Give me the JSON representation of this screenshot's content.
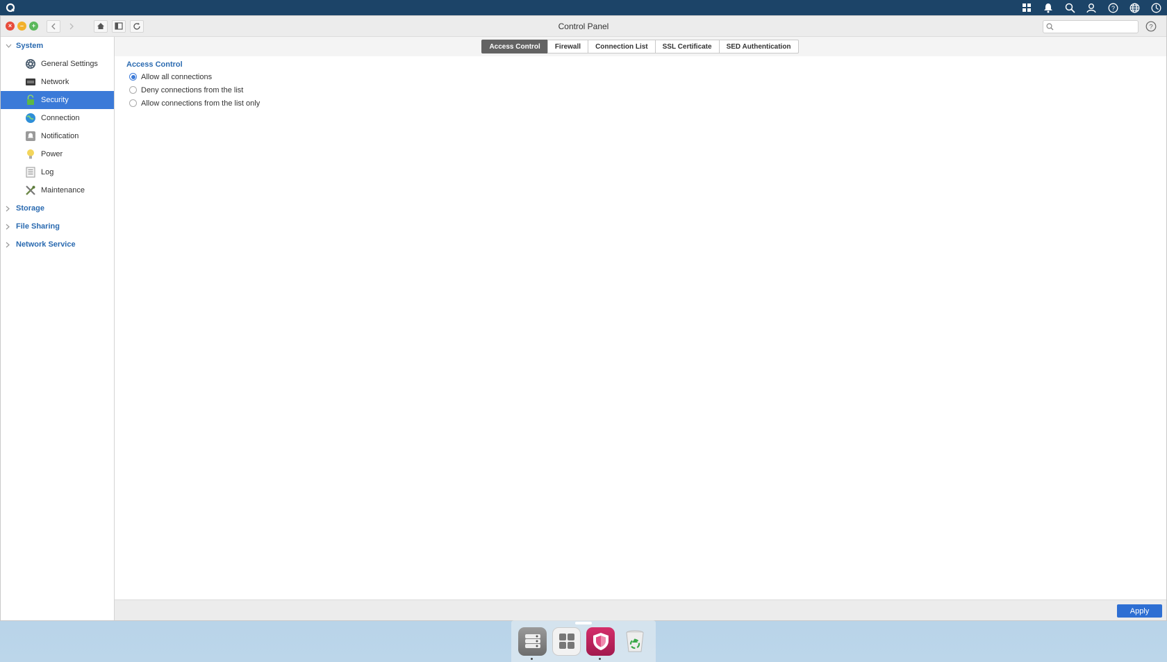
{
  "window": {
    "title": "Control Panel"
  },
  "search": {
    "placeholder": ""
  },
  "sidebar": {
    "groups": [
      {
        "label": "System",
        "expanded": true,
        "items": [
          {
            "label": "General Settings",
            "icon": "gear-icon"
          },
          {
            "label": "Network",
            "icon": "network-icon"
          },
          {
            "label": "Security",
            "icon": "lock-icon",
            "active": true
          },
          {
            "label": "Connection",
            "icon": "globe-icon"
          },
          {
            "label": "Notification",
            "icon": "notification-icon"
          },
          {
            "label": "Power",
            "icon": "lightbulb-icon"
          },
          {
            "label": "Log",
            "icon": "log-icon"
          },
          {
            "label": "Maintenance",
            "icon": "tools-icon"
          }
        ]
      },
      {
        "label": "Storage",
        "expanded": false
      },
      {
        "label": "File Sharing",
        "expanded": false
      },
      {
        "label": "Network Service",
        "expanded": false
      }
    ]
  },
  "tabs": [
    {
      "label": "Access Control",
      "active": true
    },
    {
      "label": "Firewall"
    },
    {
      "label": "Connection List"
    },
    {
      "label": "SSL Certificate"
    },
    {
      "label": "SED Authentication"
    }
  ],
  "access_control": {
    "title": "Access Control",
    "options": [
      {
        "label": "Allow all connections",
        "checked": true
      },
      {
        "label": "Deny connections from the list",
        "checked": false
      },
      {
        "label": "Allow connections from the list only",
        "checked": false
      }
    ]
  },
  "footer": {
    "apply_label": "Apply"
  },
  "colors": {
    "accent": "#3b7ad8",
    "topbar": "#1c4468",
    "link": "#2a6ab0",
    "apply": "#2e6fd3"
  }
}
